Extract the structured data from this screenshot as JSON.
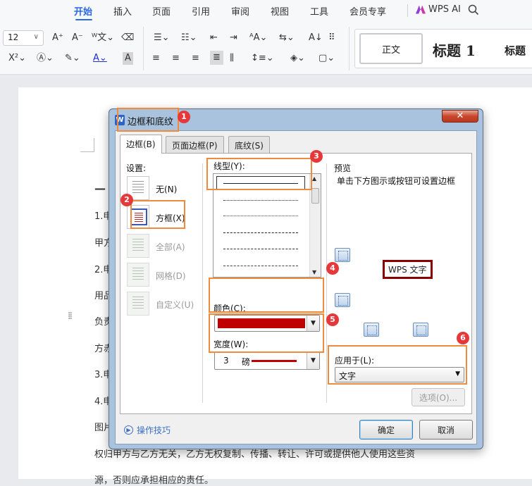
{
  "ribbon": {
    "menus": [
      "开始",
      "插入",
      "页面",
      "引用",
      "审阅",
      "视图",
      "工具",
      "会员专享"
    ],
    "ai_label": "WPS AI",
    "font_size": "12",
    "styles": [
      "正文",
      "标题 1",
      "标题"
    ]
  },
  "document": {
    "lines": [
      "1.申",
      "甲方",
      "2.申",
      "用品",
      "负责",
      "方赤",
      "3.申",
      "4.申",
      "图片"
    ],
    "bottom_line_1": "权归甲方与乙方无关，乙方无权复制、传播、转让、许可或提供他人使用这些资",
    "bottom_line_2": "源，否则应承担相应的责任。"
  },
  "dialog": {
    "title": "边框和底纹",
    "close": "✕",
    "tabs": [
      "边框(B)",
      "页面边框(P)",
      "底纹(S)"
    ],
    "settings_label": "设置:",
    "settings": [
      {
        "label": "无(N)",
        "enabled": true
      },
      {
        "label": "方框(X)",
        "enabled": true
      },
      {
        "label": "全部(A)",
        "enabled": false
      },
      {
        "label": "网格(D)",
        "enabled": false
      },
      {
        "label": "自定义(U)",
        "enabled": false
      }
    ],
    "linestyle_label": "线型(Y):",
    "color_label": "颜色(C):",
    "color_value": "#c00000",
    "width_label": "宽度(W):",
    "width_value": "3",
    "width_unit": "磅",
    "preview_label": "预览",
    "preview_hint": "单击下方图示或按钮可设置边框",
    "preview_sample": "WPS 文字",
    "apply_label": "应用于(L):",
    "apply_value": "文字",
    "options_button": "选项(O)...",
    "tips_label": "操作技巧",
    "ok_button": "确定",
    "cancel_button": "取消"
  },
  "annotations": [
    "1",
    "2",
    "3",
    "4",
    "5",
    "6"
  ],
  "colors": {
    "accent": "#2b67e8",
    "highlight": "#f08a3c",
    "badge": "#e6383a",
    "border_color": "#c00000"
  }
}
